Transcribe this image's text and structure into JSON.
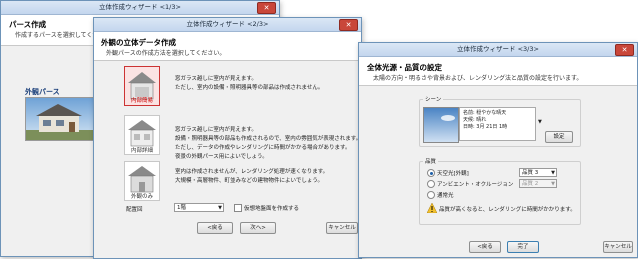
{
  "window1": {
    "title": "立体作成ウィザード <1/3>",
    "close_glyph": "✕",
    "header_title": "パース作成",
    "header_desc": "作成するパースを選択してください。",
    "perspective_label": "外観パース"
  },
  "window2": {
    "title": "立体作成ウィザード <2/3>",
    "close_glyph": "✕",
    "header_title": "外観の立体データ作成",
    "header_desc": "外観パースの作成方法を選択してください。",
    "options": [
      {
        "label": "内部簡易",
        "lines": [
          "窓ガラス越しに室内が見えます。",
          "ただし、室内の設備・照明器具等の部品は作成されません。"
        ]
      },
      {
        "label": "内部詳細",
        "lines": [
          "窓ガラス越しに室内が見えます。",
          "設備・照明器具等の部品も作成されるので、室内の雰囲気が表現されます。",
          "ただし、データの作成やレンダリングに時間がかかる場合があります。",
          "夜景の外観パース用によいでしょう。"
        ]
      },
      {
        "label": "外観のみ",
        "lines": [
          "室内は作成されませんが、レンダリング処理が速くなります。",
          "大規模・高層物件、町並みなどの建物物件によいでしょう。"
        ]
      }
    ],
    "floor_label": "配置回",
    "floor_value": "1階",
    "checkbox_label": "仮想地盤面を作成する",
    "back_label": "<戻る",
    "next_label": "次へ>",
    "cancel_label": "キャンセル"
  },
  "window3": {
    "title": "立体作成ウィザード <3/3>",
    "close_glyph": "✕",
    "header_title": "全体光源・品質の設定",
    "header_desc": "太陽の方向・明るさや背景および、レンダリング法と品質の設定を行います。",
    "scene_group": "シーン",
    "scene_name": "名前: 穏やかな晴天",
    "scene_weather": "天候: 晴れ",
    "scene_date": "日時: 3月 21日 1時",
    "settings_label": "設定",
    "quality_group": "品質",
    "radios": [
      "天空光[外観]",
      "アンビエント・オクルージョン",
      "通常光"
    ],
    "quality1": "品質 3",
    "quality2": "品質 2",
    "warning_text": "品質が高くなると、レンダリングに時間がかかります。",
    "back_label": "<戻る",
    "finish_label": "完了",
    "cancel_label": "キャンセル"
  }
}
